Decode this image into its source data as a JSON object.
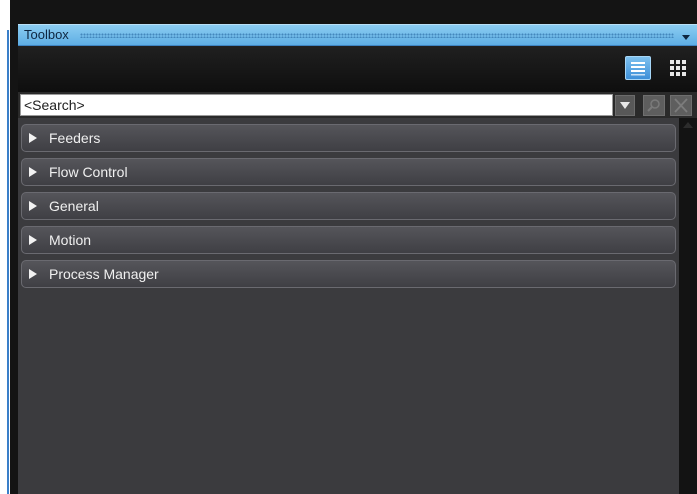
{
  "toolbox": {
    "title": "Toolbox",
    "title_menu_icon": "chevron-down-icon",
    "pin_icon": "pin-icon",
    "view_buttons": [
      {
        "name": "list-view-button",
        "icon": "list-icon",
        "active": true
      },
      {
        "name": "grid-view-button",
        "icon": "grid-icon",
        "active": false
      }
    ],
    "search": {
      "value": "<Search>",
      "placeholder": "<Search>",
      "dropdown_icon": "caret-down-icon",
      "go_icon": "search-icon",
      "clear_icon": "close-icon"
    },
    "categories": [
      {
        "label": "Feeders",
        "expanded": false
      },
      {
        "label": "Flow Control",
        "expanded": false
      },
      {
        "label": "General",
        "expanded": false
      },
      {
        "label": "Motion",
        "expanded": false
      },
      {
        "label": "Process Manager",
        "expanded": false
      }
    ]
  },
  "colors": {
    "accent": "#5eaee4",
    "panel_background": "#3b3b3e",
    "category_background": "#4a4a4f",
    "active_view_button": "#3d8fd8"
  }
}
